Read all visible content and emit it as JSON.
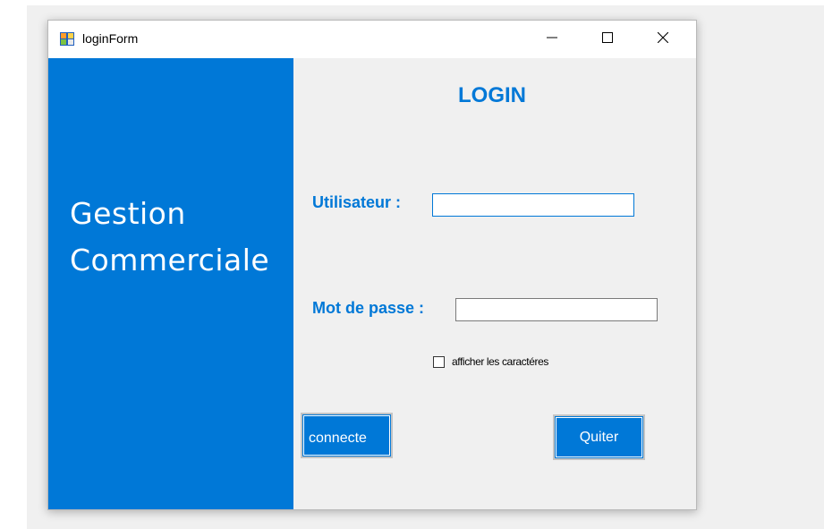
{
  "window": {
    "title": "loginForm",
    "app_icon": "winform-app-icon",
    "controls": {
      "minimize": "minimize-icon",
      "maximize": "maximize-icon",
      "close": "close-icon"
    }
  },
  "brand": {
    "line1": "Gestion",
    "line2": "Commerciale"
  },
  "form": {
    "heading": "LOGIN",
    "username_label": "Utilisateur :",
    "username_value": "",
    "password_label": "Mot de passe :",
    "password_value": "",
    "show_chars_label": "afficher les caractéres",
    "show_chars_checked": false,
    "connect_button": "connecte",
    "quit_button": "Quiter"
  },
  "colors": {
    "accent": "#0078d7",
    "background": "#f0f0f0",
    "titlebar": "#ffffff",
    "text_on_accent": "#ffffff"
  }
}
